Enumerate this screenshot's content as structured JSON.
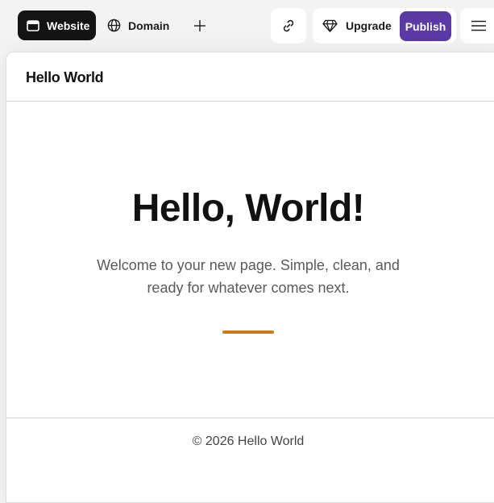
{
  "toolbar": {
    "tabs": [
      {
        "label": "Website",
        "icon": "browser-window-icon",
        "active": true
      },
      {
        "label": "Domain",
        "icon": "globe-icon",
        "active": false
      }
    ],
    "add_icon": "plus-icon",
    "link_icon": "link-icon",
    "upgrade_label": "Upgrade",
    "upgrade_icon": "diamond-icon",
    "publish_label": "Publish",
    "menu_icon": "hamburger-menu-icon",
    "colors": {
      "active_tab": "#141414",
      "publish": "#5b3aa6"
    }
  },
  "site": {
    "header_title": "Hello World",
    "hero_title": "Hello, World!",
    "hero_text_line1": "Welcome to your new page. Simple, clean, and",
    "hero_text_line2": "ready for whatever comes next.",
    "accent_color": "#c97a20",
    "footer_text": "© 2026 Hello World"
  }
}
